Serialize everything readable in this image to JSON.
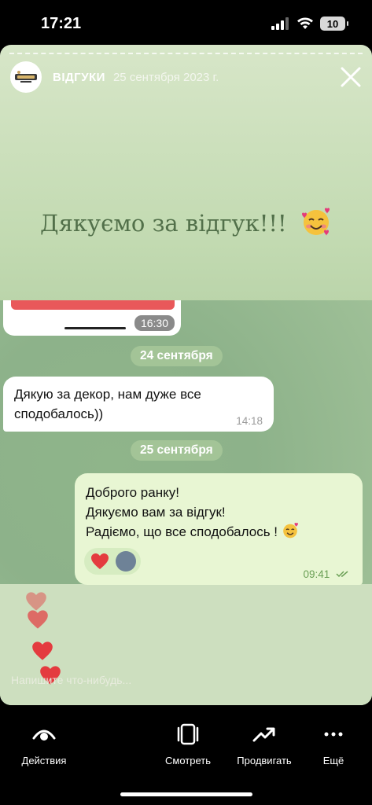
{
  "status": {
    "time": "17:21",
    "battery": "10"
  },
  "story": {
    "title": "ВІДГУКИ",
    "date": "25 сентября 2023 г.",
    "heading": "Дякуємо за відгук!!!",
    "reply_placeholder": "Напишите что-нибудь..."
  },
  "chat": {
    "first_time": "16:30",
    "date1": "24 сентября",
    "incoming": {
      "text": "Дякую за декор, нам дуже все сподобалось))",
      "time": "14:18"
    },
    "date2": "25 сентября",
    "outgoing": {
      "line1": "Доброго ранку!",
      "line2": "Дякуємо вам за відгук!",
      "line3": "Радіємо, що все сподобалось !",
      "time": "09:41"
    }
  },
  "nav": {
    "actions": "Действия",
    "watch": "Смотреть",
    "promote": "Продвигать",
    "more": "Ещё"
  },
  "colors": {
    "heart": "#e43b3f",
    "heading": "#52704a",
    "date_pill": "#a3c497"
  }
}
